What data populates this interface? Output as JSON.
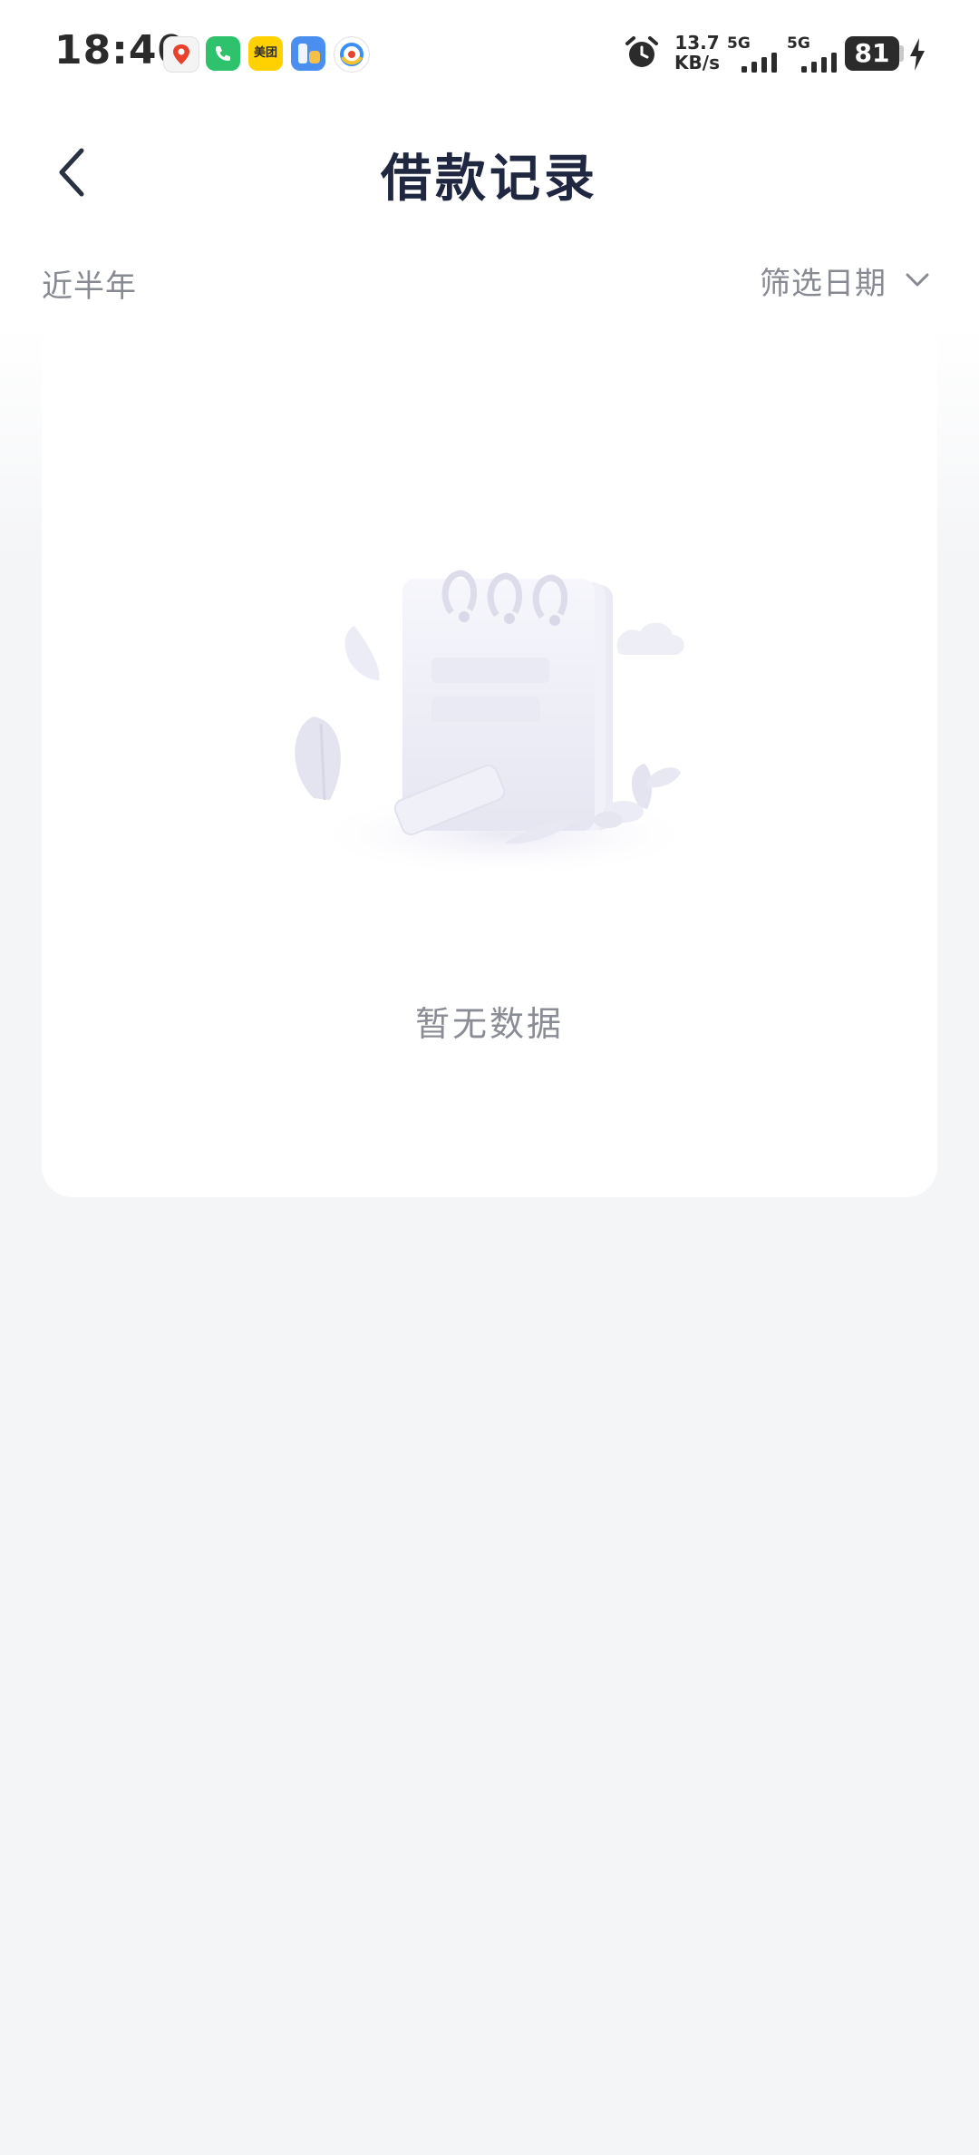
{
  "status_bar": {
    "time": "18:40",
    "net_speed_value": "13.7",
    "net_speed_unit": "KB/s",
    "network_1": "5G",
    "network_2": "5G",
    "battery": "81",
    "app_icons": [
      "map-app-icon",
      "phone-app-icon",
      "meituan-app-icon",
      "files-app-icon",
      "browser-app-icon"
    ],
    "meituan_label": "美团"
  },
  "header": {
    "title": "借款记录"
  },
  "filter": {
    "period": "近半年",
    "date_filter_label": "筛选日期"
  },
  "empty_state": {
    "message": "暂无数据"
  },
  "colors": {
    "background": "#f4f5f7",
    "card": "#ffffff",
    "title": "#1f2840",
    "muted_text": "#878a92"
  }
}
